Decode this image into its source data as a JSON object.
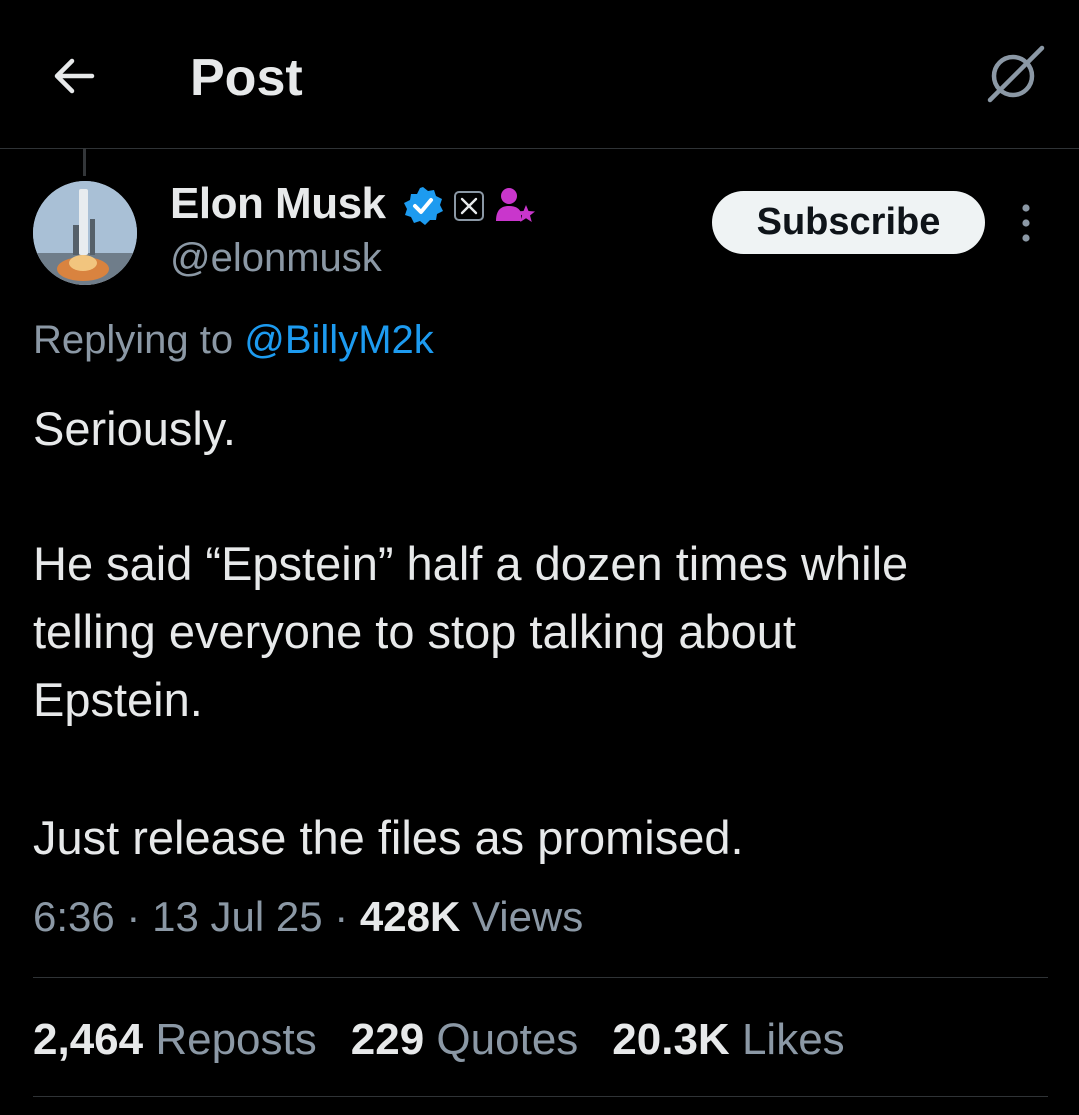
{
  "header": {
    "title": "Post",
    "back_icon": "arrow-left-icon",
    "grok_icon": "grok-icon"
  },
  "author": {
    "name": "Elon Musk",
    "handle": "@elonmusk",
    "verified_badge_color": "#1d9bf0",
    "badges": [
      "verified-badge-icon",
      "x-affiliate-icon",
      "subscriber-icon"
    ],
    "subscribe_label": "Subscribe",
    "more_icon": "more-vertical-icon"
  },
  "reply": {
    "prefix": "Replying to",
    "target": "@BillyM2k"
  },
  "post": {
    "lines": [
      "Seriously.",
      "He said “Epstein” half a dozen times while",
      "telling everyone to stop talking about",
      "Epstein.",
      "Just release the files as promised."
    ]
  },
  "meta": {
    "time": "6:36",
    "sep1": "·",
    "date": "13 Jul 25",
    "sep2": "·",
    "views_count": "428K",
    "views_label": "Views"
  },
  "stats": {
    "reposts_count": "2,464",
    "reposts_label": "Reposts",
    "quotes_count": "229",
    "quotes_label": "Quotes",
    "likes_count": "20.3K",
    "likes_label": "Likes"
  },
  "colors": {
    "background": "#000000",
    "text": "#e7e9ea",
    "secondary": "#8b98a5",
    "link": "#1d9bf0",
    "subscriber_badge": "#c936cc"
  }
}
